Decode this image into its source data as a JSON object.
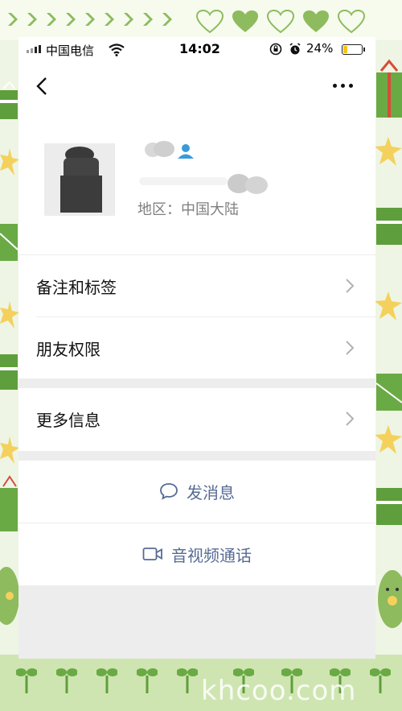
{
  "status_bar": {
    "carrier": "中国电信",
    "time": "14:02",
    "battery_percent": "24%",
    "battery_level": 0.24
  },
  "profile": {
    "region_label": "地区：",
    "region_value": "中国大陆"
  },
  "menu": {
    "items": [
      {
        "label": "备注和标签"
      },
      {
        "label": "朋友权限"
      },
      {
        "label": "更多信息"
      }
    ]
  },
  "actions": {
    "message": "发消息",
    "call": "音视频通话"
  },
  "watermark": "khcoo.com",
  "colors": {
    "link": "#576b95",
    "background": "#ededed",
    "battery": "#f5c518",
    "frame_green": "#8dbb5e"
  }
}
